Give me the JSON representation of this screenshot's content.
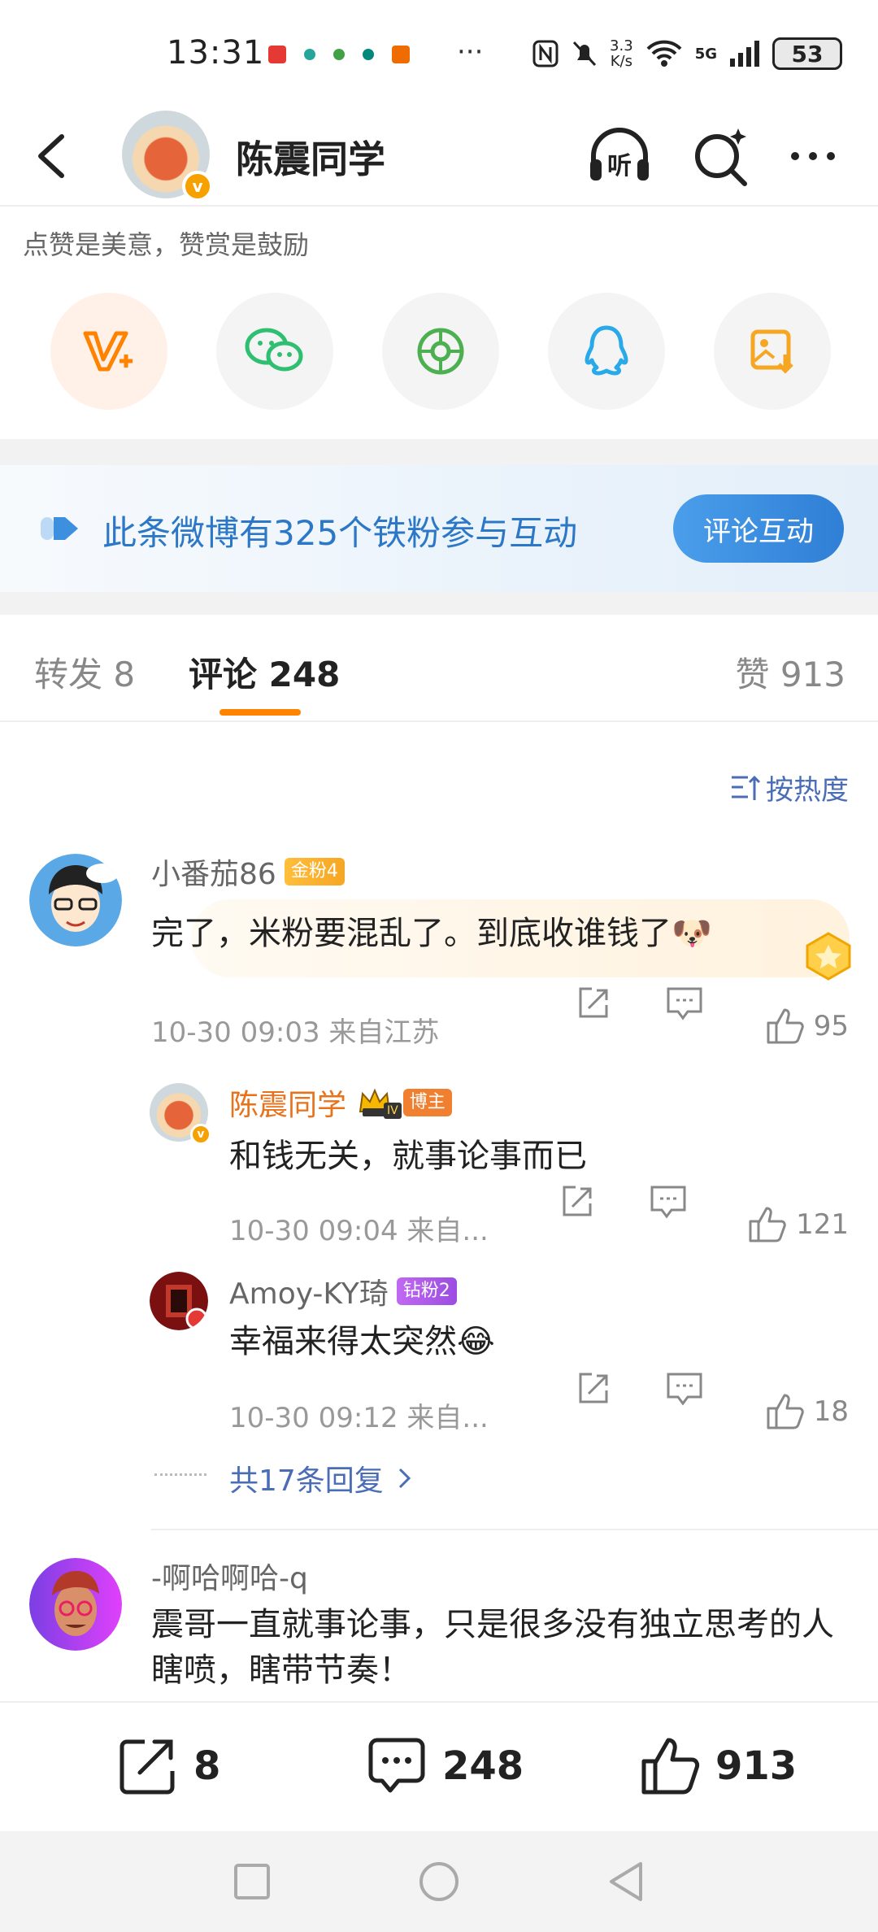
{
  "status_bar": {
    "time": "13:31",
    "more": "···",
    "speed_value": "3.3",
    "speed_unit": "K/s",
    "network": "5G",
    "battery": "53"
  },
  "header": {
    "title": "陈震同学"
  },
  "share": {
    "hint": "点赞是美意，赞赏是鼓励",
    "items": [
      "reward-icon",
      "wechat-icon",
      "moments-icon",
      "qq-icon",
      "save-image-icon"
    ]
  },
  "fans_banner": {
    "text": "此条微博有325个铁粉参与互动",
    "button": "评论互动"
  },
  "tabs": {
    "repost": "转发 8",
    "comments": "评论 248",
    "likes": "赞 913"
  },
  "sort": {
    "label": "按热度"
  },
  "comments": [
    {
      "user": "小番茄86",
      "badge": "金粉4",
      "text": "完了，米粉要混乱了。到底收谁钱了🐶",
      "time_location": "10-30 09:03  来自江苏",
      "likes": "95"
    },
    {
      "user": "-啊哈啊哈-q",
      "text": "震哥一直就事论事，只是很多没有独立思考的人瞎喷，瞎带节奏！"
    }
  ],
  "replies": [
    {
      "user": "陈震同学",
      "level": "IV",
      "badge": "博主",
      "text": "和钱无关，就事论事而已",
      "time_location": "10-30 09:04  来自...",
      "likes": "121"
    },
    {
      "user": "Amoy-KY琦",
      "badge": "钻粉2",
      "text": "幸福来得太突然😂",
      "time_location": "10-30 09:12  来自...",
      "likes": "18"
    }
  ],
  "more_replies": "共17条回复",
  "bottom_bar": {
    "reposts": "8",
    "comments": "248",
    "likes": "913"
  },
  "colors": {
    "accent": "#ff8200",
    "link": "#4a6db6",
    "banner_text": "#2c78c7",
    "blogger_name": "#e8711a"
  }
}
